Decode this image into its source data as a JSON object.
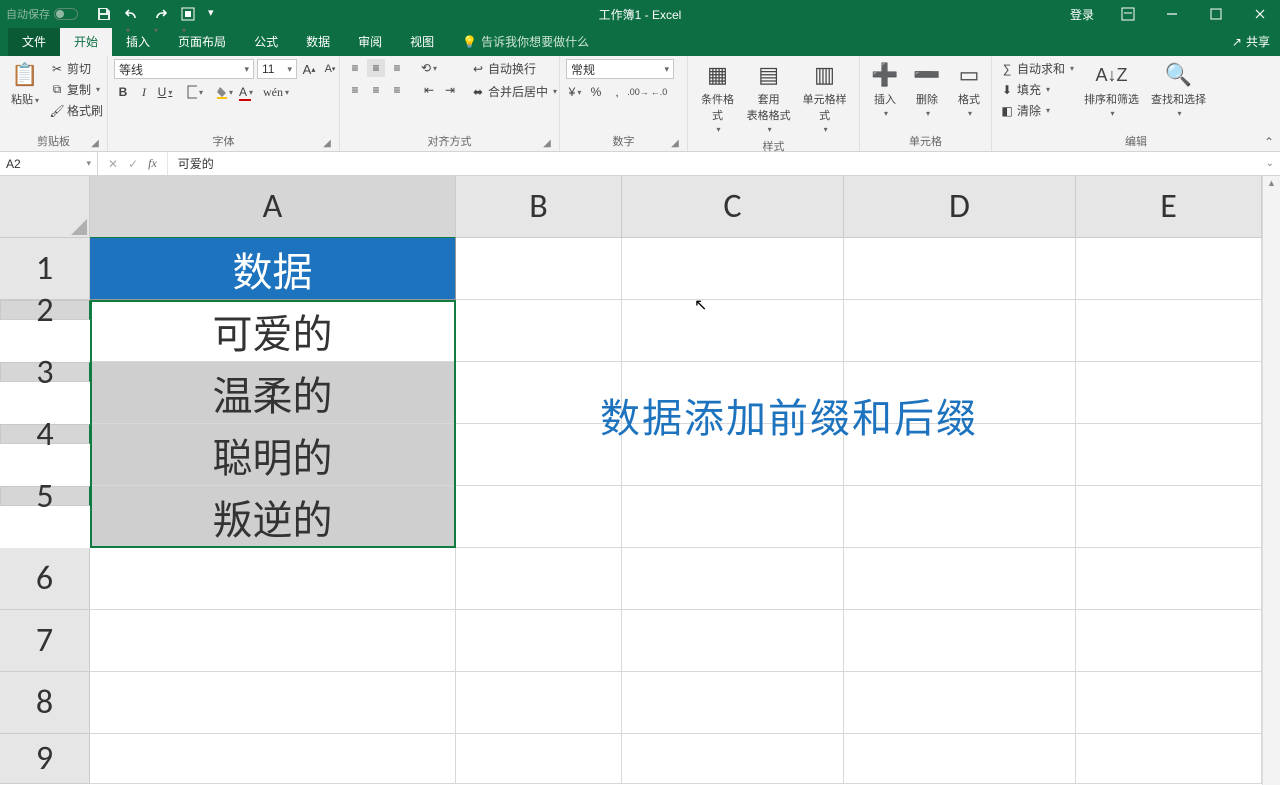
{
  "titlebar": {
    "auto_save": "自动保存",
    "title": "工作簿1 - Excel",
    "login": "登录"
  },
  "tabs": {
    "file": "文件",
    "home": "开始",
    "insert": "插入",
    "layout": "页面布局",
    "formula": "公式",
    "data_tab": "数据",
    "review": "审阅",
    "view": "视图",
    "tellme": "告诉我你想要做什么",
    "share": "共享"
  },
  "ribbon": {
    "clipboard": {
      "label": "剪贴板",
      "paste": "粘贴",
      "cut": "剪切",
      "copy": "复制",
      "painter": "格式刷"
    },
    "font": {
      "label": "字体",
      "name": "等线",
      "size": "11"
    },
    "align": {
      "label": "对齐方式",
      "wrap": "自动换行",
      "merge": "合并后居中"
    },
    "number": {
      "label": "数字",
      "format": "常规"
    },
    "styles": {
      "label": "样式",
      "cond": "条件格式",
      "table": "套用\n表格格式",
      "cell": "单元格样式"
    },
    "cells": {
      "label": "单元格",
      "insert": "插入",
      "delete": "删除",
      "format": "格式"
    },
    "editing": {
      "label": "编辑",
      "sum": "自动求和",
      "fill": "填充",
      "clear": "清除",
      "sort": "排序和筛选",
      "find": "查找和选择"
    }
  },
  "fbar": {
    "ref": "A2",
    "value": "可爱的"
  },
  "grid": {
    "cols": [
      "A",
      "B",
      "C",
      "D",
      "E"
    ],
    "rows": [
      "1",
      "2",
      "3",
      "4",
      "5",
      "6",
      "7",
      "8",
      "9"
    ],
    "a1": "数据",
    "a2": "可爱的",
    "a3": "温柔的",
    "a4": "聪明的",
    "a5": "叛逆的",
    "annotation": "数据添加前缀和后缀"
  }
}
